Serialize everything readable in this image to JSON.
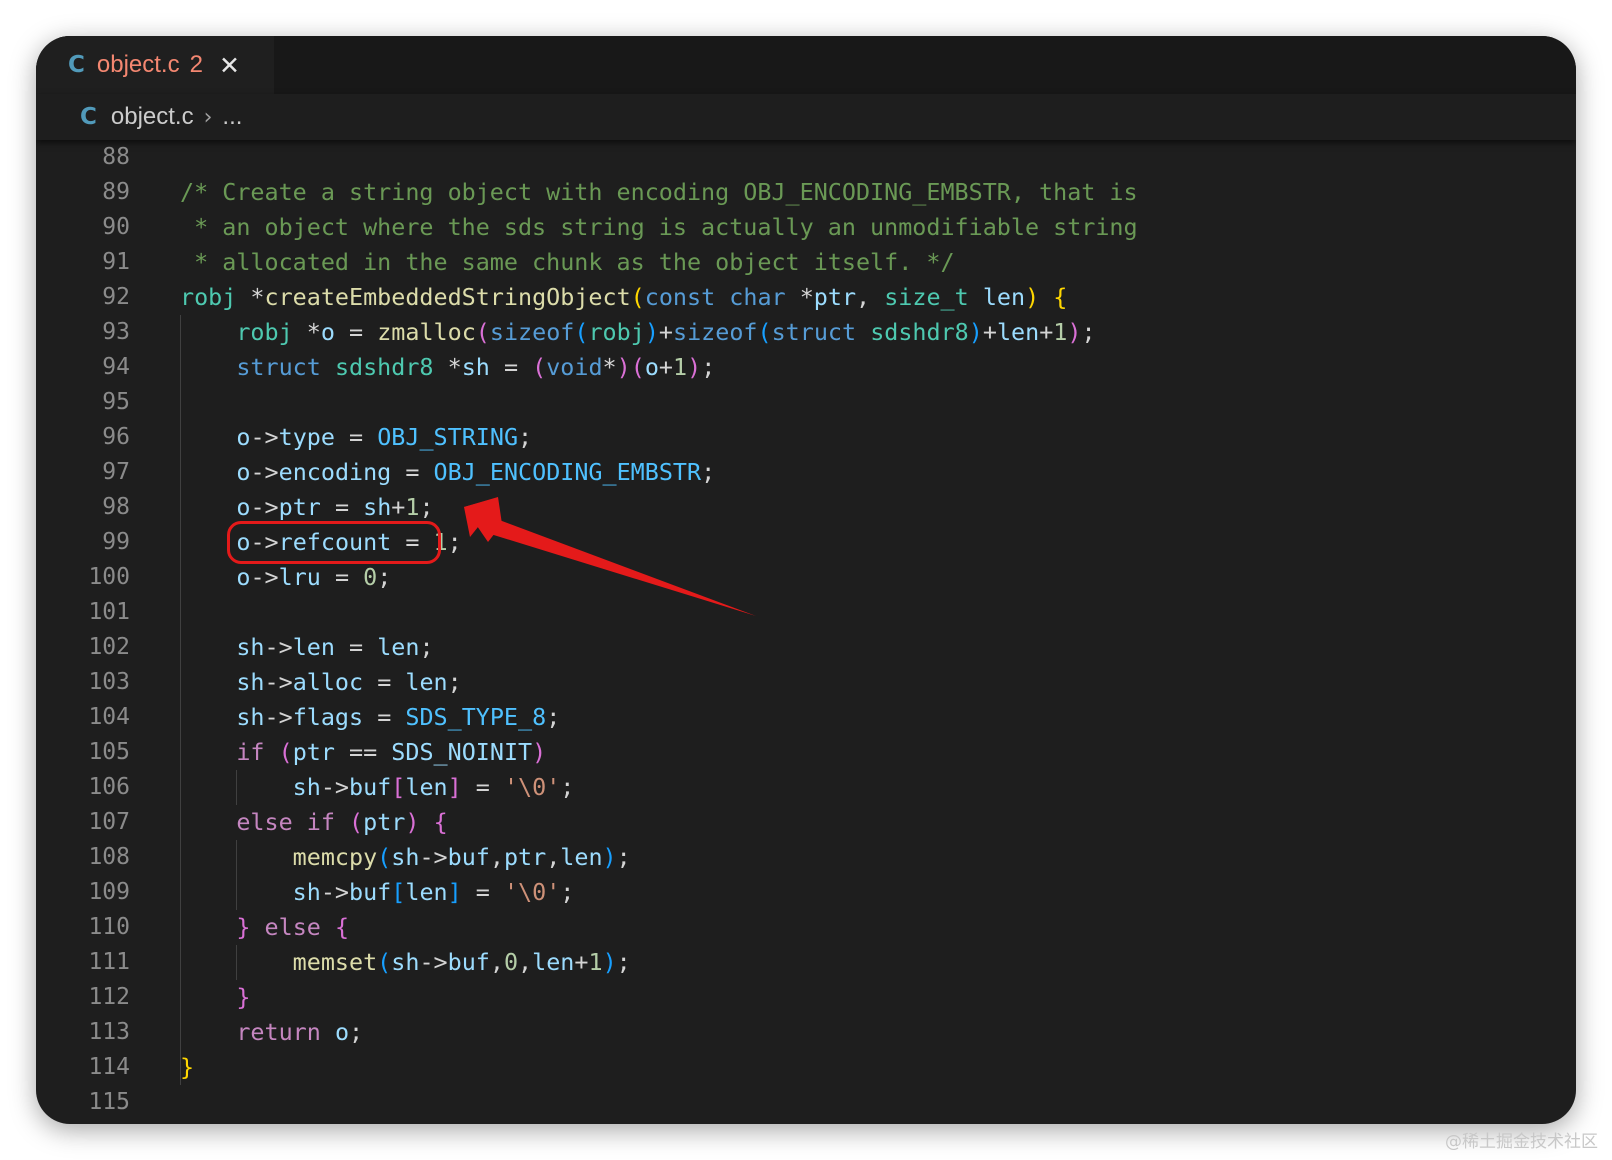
{
  "tab": {
    "filename": "object.c",
    "problem_count": "2",
    "icon": "c-language-icon",
    "close_icon": "close-icon"
  },
  "breadcrumb": {
    "filename": "object.c",
    "separator_icon": "chevron-right-icon",
    "more": "..."
  },
  "watermark": "@稀土掘金技术社区",
  "colors": {
    "comment": "#6a9955",
    "keyword": "#569cd6",
    "control": "#c586c0",
    "type": "#4ec9b0",
    "function": "#dcdcaa",
    "variable": "#9cdcfe",
    "constant": "#4fc1ff",
    "number": "#b5cea8",
    "string": "#ce9178",
    "bracket1": "#ffd700",
    "bracket2": "#da70d6",
    "bracket3": "#179fff",
    "highlight": "#e41a1a"
  },
  "lines": [
    {
      "n": "88",
      "t": []
    },
    {
      "n": "89",
      "t": [
        [
          "/* Create a string object with encoding OBJ_ENCODING_EMBSTR, that is",
          "comment"
        ]
      ]
    },
    {
      "n": "90",
      "t": [
        [
          " * an object where the sds string is actually an unmodifiable string",
          "comment"
        ]
      ]
    },
    {
      "n": "91",
      "t": [
        [
          " * allocated in the same chunk as the object itself. */",
          "comment"
        ]
      ]
    },
    {
      "n": "92",
      "t": [
        [
          "robj",
          "type"
        ],
        [
          " *",
          ""
        ],
        [
          "createEmbeddedStringObject",
          "function"
        ],
        [
          "(",
          "bracket1"
        ],
        [
          "const",
          "keyword"
        ],
        [
          " ",
          ""
        ],
        [
          "char",
          "keyword"
        ],
        [
          " *",
          ""
        ],
        [
          "ptr",
          "variable"
        ],
        [
          ", ",
          ""
        ],
        [
          "size_t",
          "type"
        ],
        [
          " ",
          ""
        ],
        [
          "len",
          "variable"
        ],
        [
          ")",
          "bracket1"
        ],
        [
          " ",
          ""
        ],
        [
          "{",
          "bracket1"
        ]
      ]
    },
    {
      "n": "93",
      "t": [
        [
          "    ",
          ""
        ],
        [
          "robj",
          "type"
        ],
        [
          " *",
          ""
        ],
        [
          "o",
          "variable"
        ],
        [
          " = ",
          ""
        ],
        [
          "zmalloc",
          "function"
        ],
        [
          "(",
          "bracket2"
        ],
        [
          "sizeof",
          "keyword"
        ],
        [
          "(",
          "bracket3"
        ],
        [
          "robj",
          "type"
        ],
        [
          ")",
          "bracket3"
        ],
        [
          "+",
          ""
        ],
        [
          "sizeof",
          "keyword"
        ],
        [
          "(",
          "bracket3"
        ],
        [
          "struct",
          "keyword"
        ],
        [
          " ",
          ""
        ],
        [
          "sdshdr8",
          "type"
        ],
        [
          ")",
          "bracket3"
        ],
        [
          "+",
          ""
        ],
        [
          "len",
          "variable"
        ],
        [
          "+",
          ""
        ],
        [
          "1",
          "number"
        ],
        [
          ")",
          "bracket2"
        ],
        [
          ";",
          ""
        ]
      ]
    },
    {
      "n": "94",
      "t": [
        [
          "    ",
          ""
        ],
        [
          "struct",
          "keyword"
        ],
        [
          " ",
          ""
        ],
        [
          "sdshdr8",
          "type"
        ],
        [
          " *",
          ""
        ],
        [
          "sh",
          "variable"
        ],
        [
          " = ",
          ""
        ],
        [
          "(",
          "bracket2"
        ],
        [
          "void",
          "keyword"
        ],
        [
          "*",
          ""
        ],
        [
          ")",
          "bracket2"
        ],
        [
          "(",
          "bracket2"
        ],
        [
          "o",
          "variable"
        ],
        [
          "+",
          ""
        ],
        [
          "1",
          "number"
        ],
        [
          ")",
          "bracket2"
        ],
        [
          ";",
          ""
        ]
      ]
    },
    {
      "n": "95",
      "t": []
    },
    {
      "n": "96",
      "t": [
        [
          "    ",
          ""
        ],
        [
          "o",
          "variable"
        ],
        [
          "->",
          ""
        ],
        [
          "type",
          "variable"
        ],
        [
          " = ",
          ""
        ],
        [
          "OBJ_STRING",
          "constant"
        ],
        [
          ";",
          ""
        ]
      ]
    },
    {
      "n": "97",
      "t": [
        [
          "    ",
          ""
        ],
        [
          "o",
          "variable"
        ],
        [
          "->",
          ""
        ],
        [
          "encoding",
          "variable"
        ],
        [
          " = ",
          ""
        ],
        [
          "OBJ_ENCODING_EMBSTR",
          "constant"
        ],
        [
          ";",
          ""
        ]
      ]
    },
    {
      "n": "98",
      "t": [
        [
          "    ",
          ""
        ],
        [
          "o",
          "variable"
        ],
        [
          "->",
          ""
        ],
        [
          "ptr",
          "variable"
        ],
        [
          " = ",
          ""
        ],
        [
          "sh",
          "variable"
        ],
        [
          "+",
          ""
        ],
        [
          "1",
          "number"
        ],
        [
          ";",
          ""
        ]
      ]
    },
    {
      "n": "99",
      "t": [
        [
          "    ",
          ""
        ],
        [
          "o",
          "variable"
        ],
        [
          "->",
          ""
        ],
        [
          "refcount",
          "variable"
        ],
        [
          " = ",
          ""
        ],
        [
          "1",
          "number"
        ],
        [
          ";",
          ""
        ]
      ]
    },
    {
      "n": "100",
      "t": [
        [
          "    ",
          ""
        ],
        [
          "o",
          "variable"
        ],
        [
          "->",
          ""
        ],
        [
          "lru",
          "variable"
        ],
        [
          " = ",
          ""
        ],
        [
          "0",
          "number"
        ],
        [
          ";",
          ""
        ]
      ]
    },
    {
      "n": "101",
      "t": []
    },
    {
      "n": "102",
      "t": [
        [
          "    ",
          ""
        ],
        [
          "sh",
          "variable"
        ],
        [
          "->",
          ""
        ],
        [
          "len",
          "variable"
        ],
        [
          " = ",
          ""
        ],
        [
          "len",
          "variable"
        ],
        [
          ";",
          ""
        ]
      ]
    },
    {
      "n": "103",
      "t": [
        [
          "    ",
          ""
        ],
        [
          "sh",
          "variable"
        ],
        [
          "->",
          ""
        ],
        [
          "alloc",
          "variable"
        ],
        [
          " = ",
          ""
        ],
        [
          "len",
          "variable"
        ],
        [
          ";",
          ""
        ]
      ]
    },
    {
      "n": "104",
      "t": [
        [
          "    ",
          ""
        ],
        [
          "sh",
          "variable"
        ],
        [
          "->",
          ""
        ],
        [
          "flags",
          "variable"
        ],
        [
          " = ",
          ""
        ],
        [
          "SDS_TYPE_8",
          "constant"
        ],
        [
          ";",
          ""
        ]
      ]
    },
    {
      "n": "105",
      "t": [
        [
          "    ",
          ""
        ],
        [
          "if",
          "control"
        ],
        [
          " ",
          ""
        ],
        [
          "(",
          "bracket2"
        ],
        [
          "ptr",
          "variable"
        ],
        [
          " == ",
          ""
        ],
        [
          "SDS_NOINIT",
          "variable"
        ],
        [
          ")",
          "bracket2"
        ]
      ]
    },
    {
      "n": "106",
      "t": [
        [
          "        ",
          ""
        ],
        [
          "sh",
          "variable"
        ],
        [
          "->",
          ""
        ],
        [
          "buf",
          "variable"
        ],
        [
          "[",
          "bracket2"
        ],
        [
          "len",
          "variable"
        ],
        [
          "]",
          "bracket2"
        ],
        [
          " = ",
          ""
        ],
        [
          "'\\0'",
          "string"
        ],
        [
          ";",
          ""
        ]
      ]
    },
    {
      "n": "107",
      "t": [
        [
          "    ",
          ""
        ],
        [
          "else",
          "control"
        ],
        [
          " ",
          ""
        ],
        [
          "if",
          "control"
        ],
        [
          " ",
          ""
        ],
        [
          "(",
          "bracket2"
        ],
        [
          "ptr",
          "variable"
        ],
        [
          ")",
          "bracket2"
        ],
        [
          " ",
          ""
        ],
        [
          "{",
          "bracket2"
        ]
      ]
    },
    {
      "n": "108",
      "t": [
        [
          "        ",
          ""
        ],
        [
          "memcpy",
          "function"
        ],
        [
          "(",
          "bracket3"
        ],
        [
          "sh",
          "variable"
        ],
        [
          "->",
          ""
        ],
        [
          "buf",
          "variable"
        ],
        [
          ",",
          ""
        ],
        [
          "ptr",
          "variable"
        ],
        [
          ",",
          ""
        ],
        [
          "len",
          "variable"
        ],
        [
          ")",
          "bracket3"
        ],
        [
          ";",
          ""
        ]
      ]
    },
    {
      "n": "109",
      "t": [
        [
          "        ",
          ""
        ],
        [
          "sh",
          "variable"
        ],
        [
          "->",
          ""
        ],
        [
          "buf",
          "variable"
        ],
        [
          "[",
          "bracket3"
        ],
        [
          "len",
          "variable"
        ],
        [
          "]",
          "bracket3"
        ],
        [
          " = ",
          ""
        ],
        [
          "'\\0'",
          "string"
        ],
        [
          ";",
          ""
        ]
      ]
    },
    {
      "n": "110",
      "t": [
        [
          "    ",
          ""
        ],
        [
          "}",
          "bracket2"
        ],
        [
          " ",
          ""
        ],
        [
          "else",
          "control"
        ],
        [
          " ",
          ""
        ],
        [
          "{",
          "bracket2"
        ]
      ]
    },
    {
      "n": "111",
      "t": [
        [
          "        ",
          ""
        ],
        [
          "memset",
          "function"
        ],
        [
          "(",
          "bracket3"
        ],
        [
          "sh",
          "variable"
        ],
        [
          "->",
          ""
        ],
        [
          "buf",
          "variable"
        ],
        [
          ",",
          ""
        ],
        [
          "0",
          "number"
        ],
        [
          ",",
          ""
        ],
        [
          "len",
          "variable"
        ],
        [
          "+",
          ""
        ],
        [
          "1",
          "number"
        ],
        [
          ")",
          "bracket3"
        ],
        [
          ";",
          ""
        ]
      ]
    },
    {
      "n": "112",
      "t": [
        [
          "    ",
          ""
        ],
        [
          "}",
          "bracket2"
        ]
      ]
    },
    {
      "n": "113",
      "t": [
        [
          "    ",
          ""
        ],
        [
          "return",
          "control"
        ],
        [
          " ",
          ""
        ],
        [
          "o",
          "variable"
        ],
        [
          ";",
          ""
        ]
      ]
    },
    {
      "n": "114",
      "t": [
        [
          "}",
          "bracket1"
        ]
      ]
    },
    {
      "n": "115",
      "t": []
    }
  ]
}
